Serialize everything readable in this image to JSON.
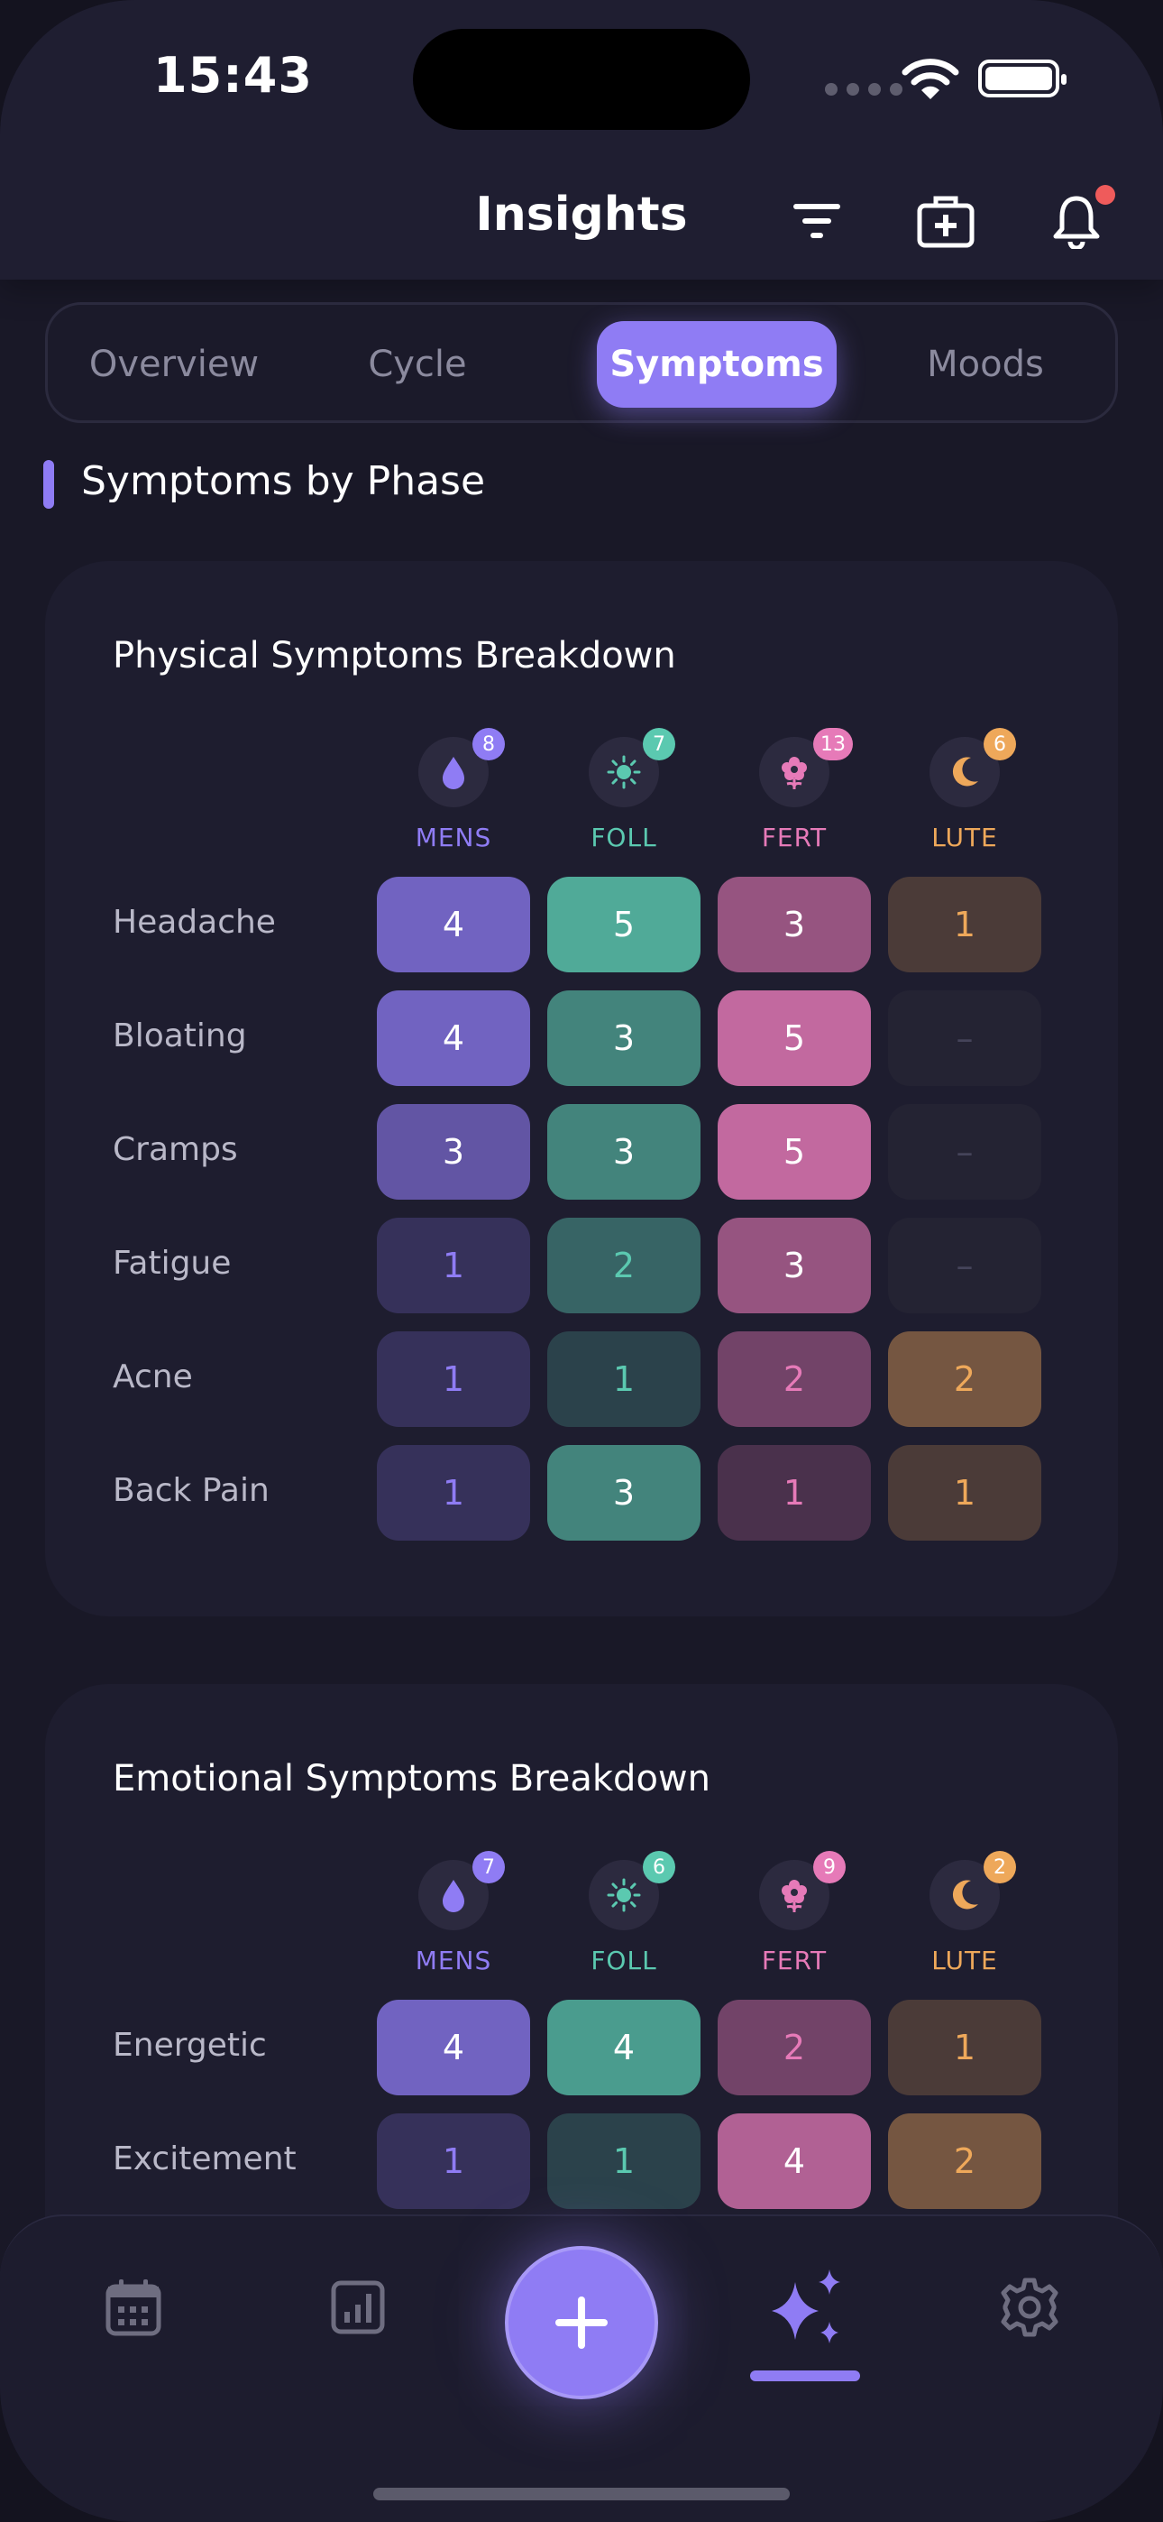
{
  "status_bar": {
    "time": "15:43"
  },
  "header": {
    "title": "Insights"
  },
  "tabs": [
    {
      "label": "Overview",
      "active": false
    },
    {
      "label": "Cycle",
      "active": false
    },
    {
      "label": "Symptoms",
      "active": true
    },
    {
      "label": "Moods",
      "active": false
    }
  ],
  "section": {
    "title": "Symptoms by Phase"
  },
  "phases": [
    {
      "label": "MENS",
      "color": "#8f7cf4",
      "icon": "droplet-icon"
    },
    {
      "label": "FOLL",
      "color": "#5bc9b0",
      "icon": "sun-icon"
    },
    {
      "label": "FERT",
      "color": "#e67ab8",
      "icon": "flower-icon"
    },
    {
      "label": "LUTE",
      "color": "#eea85a",
      "icon": "moon-icon"
    }
  ],
  "physical": {
    "title": "Physical Symptoms Breakdown",
    "badges": [
      "8",
      "7",
      "13",
      "6"
    ],
    "rows": [
      {
        "label": "Headache",
        "values": [
          "4",
          "5",
          "3",
          "1"
        ]
      },
      {
        "label": "Bloating",
        "values": [
          "4",
          "3",
          "5",
          "–"
        ]
      },
      {
        "label": "Cramps",
        "values": [
          "3",
          "3",
          "5",
          "–"
        ]
      },
      {
        "label": "Fatigue",
        "values": [
          "1",
          "2",
          "3",
          "–"
        ]
      },
      {
        "label": "Acne",
        "values": [
          "1",
          "1",
          "2",
          "2"
        ]
      },
      {
        "label": "Back Pain",
        "values": [
          "1",
          "3",
          "1",
          "1"
        ]
      }
    ]
  },
  "emotional": {
    "title": "Emotional Symptoms Breakdown",
    "badges": [
      "7",
      "6",
      "9",
      "2"
    ],
    "rows": [
      {
        "label": "Energetic",
        "values": [
          "4",
          "4",
          "2",
          "1"
        ]
      },
      {
        "label": "Excitement",
        "values": [
          "1",
          "1",
          "4",
          "2"
        ]
      }
    ]
  },
  "bottom_nav": {
    "items": [
      {
        "name": "calendar-icon",
        "active": false
      },
      {
        "name": "chart-icon",
        "active": false
      },
      {
        "name": "add-icon",
        "active": false
      },
      {
        "name": "sparkles-icon",
        "active": true
      },
      {
        "name": "gear-icon",
        "active": false
      }
    ]
  }
}
